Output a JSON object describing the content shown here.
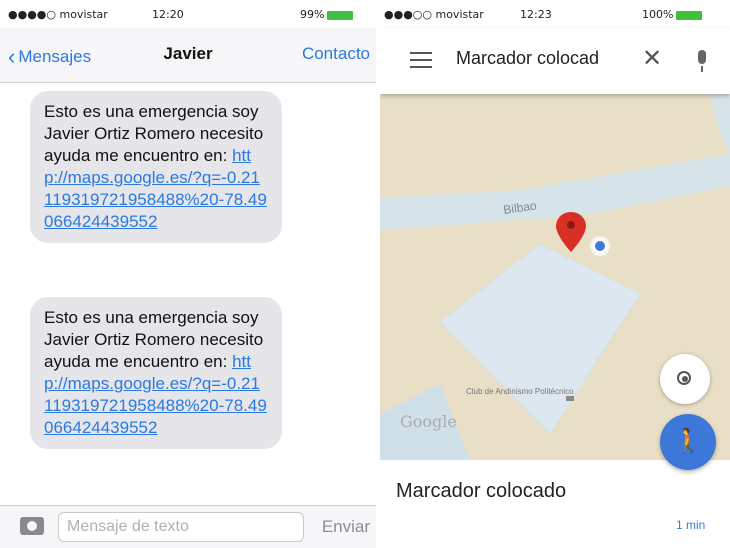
{
  "sms": {
    "status": {
      "carrier": "●●●●○ movistar",
      "time": "12:20",
      "battery": "99%"
    },
    "nav": {
      "back": "Mensajes",
      "title": "Javier",
      "contact": "Contacto"
    },
    "messages": [
      {
        "text": "Esto es una emergencia soy Javier Ortiz Romero necesito ayuda me encuentro en:",
        "link": "http://maps.google.es/?q=-0.21119319721958488%20-78.49066424439552"
      },
      {
        "text": "Esto es una emergencia soy Javier Ortiz Romero necesito ayuda me encuentro en:",
        "link": "http://maps.google.es/?q=-0.21119319721958488%20-78.49066424439552"
      }
    ],
    "compose": {
      "placeholder": "Mensaje de texto",
      "send": "Enviar"
    }
  },
  "map": {
    "status": {
      "carrier": "●●●○○ movistar",
      "time": "12:23",
      "battery": "100%"
    },
    "search": {
      "query": "Marcador colocad"
    },
    "labels": {
      "street": "Bilbao",
      "poi": "Club de Andinismo Politécnico",
      "google": "Google"
    },
    "place": {
      "name": "Marcador colocado",
      "eta": "1 min"
    },
    "colors": {
      "land": "#e8dfc6",
      "road": "#d6e3e8",
      "park": "#cde0ec",
      "pin": "#d93025",
      "fab": "#3d78d8"
    }
  }
}
